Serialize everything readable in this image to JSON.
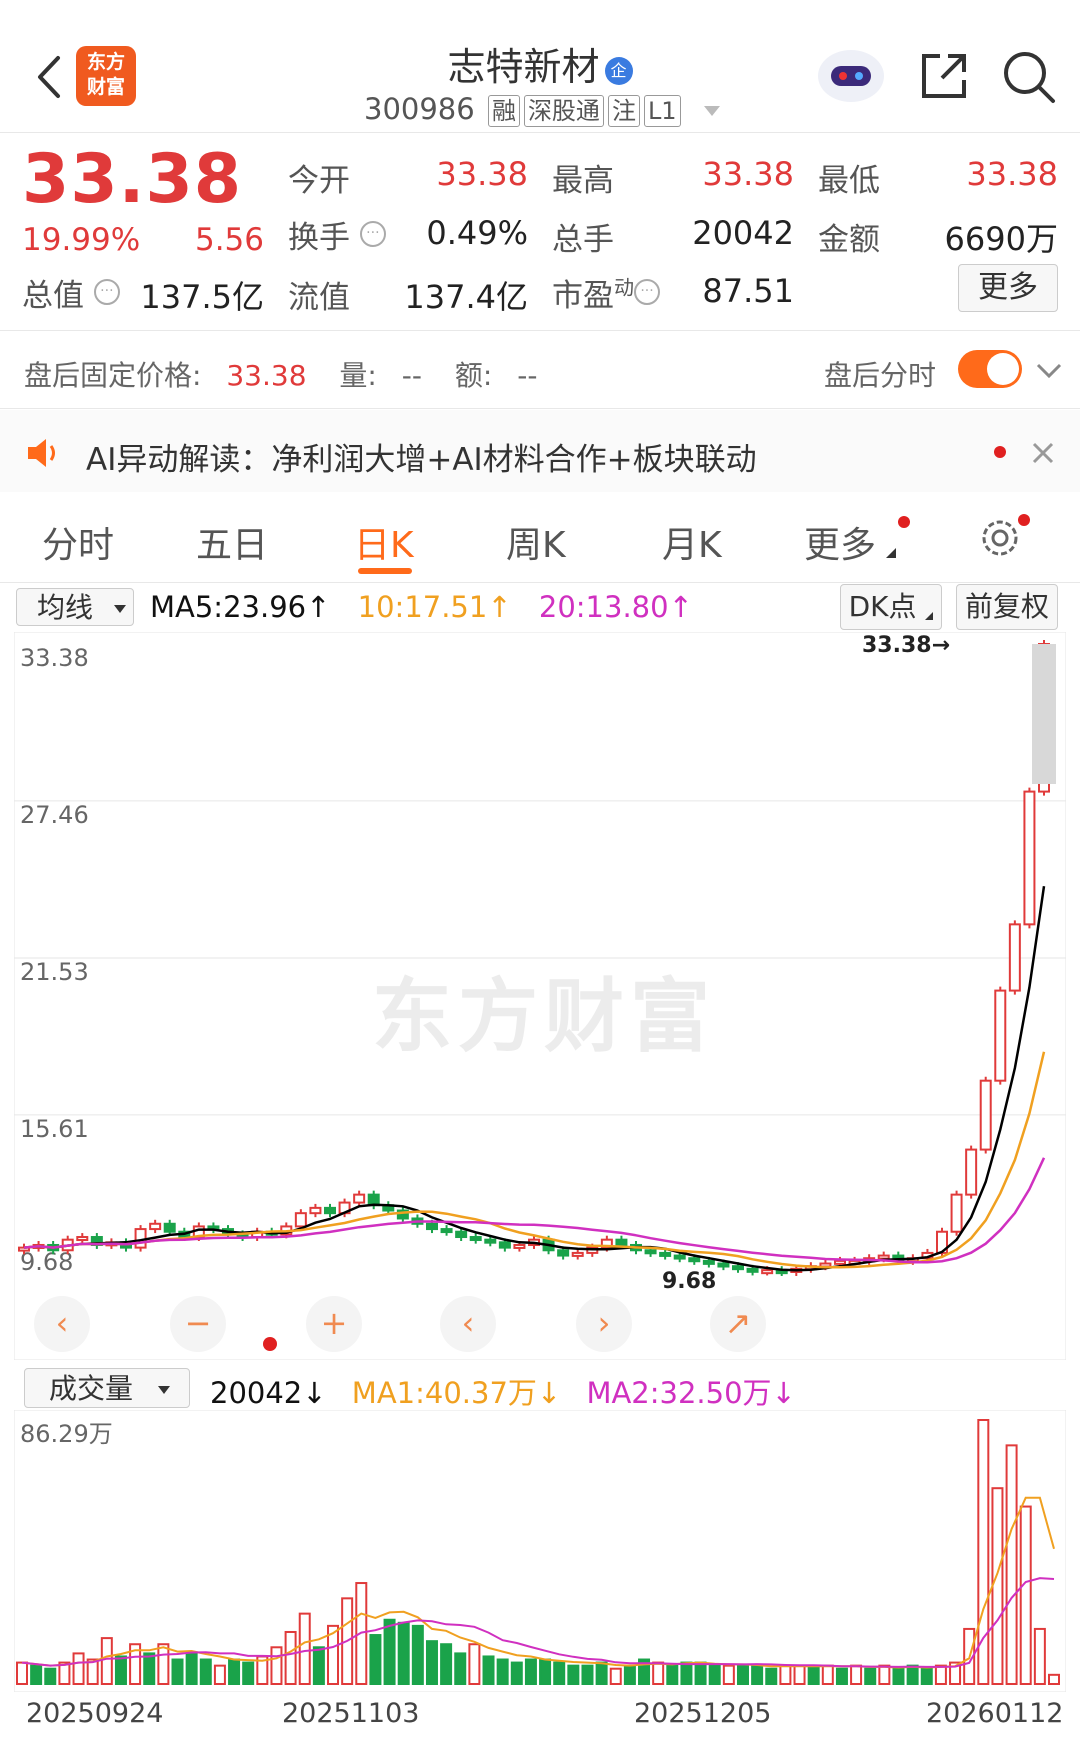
{
  "header": {
    "name": "志特新材",
    "code": "300986",
    "badges": [
      "融",
      "深股通",
      "注",
      "L1"
    ],
    "logo_lines": [
      "东方",
      "财富"
    ],
    "name_badge": "企"
  },
  "quote": {
    "price": "33.38",
    "change_pct": "19.99%",
    "change": "5.56",
    "rows": [
      [
        {
          "label": "今开",
          "value": "33.38",
          "red": true
        },
        {
          "label": "最高",
          "value": "33.38",
          "red": true
        },
        {
          "label": "最低",
          "value": "33.38",
          "red": true
        }
      ],
      [
        {
          "label": "换手",
          "value": "0.49%",
          "red": false
        },
        {
          "label": "总手",
          "value": "20042",
          "red": false
        },
        {
          "label": "金额",
          "value": "6690万",
          "red": false
        }
      ]
    ],
    "total_cap_label": "总值",
    "total_cap": "137.5亿",
    "float_cap_label": "流值",
    "float_cap": "137.4亿",
    "pe_label": "市盈",
    "pe_sup": "动",
    "pe": "87.51",
    "more_button": "更多"
  },
  "after_hours": {
    "price_label": "盘后固定价格:",
    "price": "33.38",
    "volume_label": "量:",
    "volume": "--",
    "amount_label": "额:",
    "amount": "--",
    "timeshare_label": "盘后分时",
    "toggle_on": true
  },
  "ai_banner": {
    "text": "AI异动解读：净利润大增+AI材料合作+板块联动"
  },
  "tabs": [
    "分时",
    "五日",
    "日K",
    "周K",
    "月K",
    "更多"
  ],
  "active_tab": "日K",
  "kline": {
    "indicator_select": "均线",
    "ma5": "MA5:23.96",
    "ma10": "10:17.51",
    "ma20": "20:13.80",
    "dk_button": "DK点",
    "adjust_button": "前复权",
    "watermark": "东方财富",
    "last_price_tag": "33.38",
    "low_tag": "9.68"
  },
  "volume_panel": {
    "select": "成交量",
    "value": "20042",
    "ma1": "MA1:40.37万",
    "ma2": "MA2:32.50万"
  },
  "colors": {
    "up": "#e03a3a",
    "down": "#1aa34a",
    "ma5": "#000000",
    "ma10": "#f0a020",
    "ma20": "#d030c0",
    "accent": "#ff6a1a"
  },
  "chart_data": [
    {
      "type": "candlestick",
      "y_ticks": [
        "33.38",
        "27.46",
        "21.53",
        "15.61",
        "9.68"
      ],
      "ylim": [
        9.68,
        33.38
      ],
      "x_ticks": [
        "20250924",
        "20251103",
        "20251205",
        "20260112"
      ],
      "series": [
        {
          "name": "MA5",
          "last": 23.96
        },
        {
          "name": "MA10",
          "last": 17.51
        },
        {
          "name": "MA20",
          "last": 13.8
        }
      ],
      "close": [
        10.6,
        10.7,
        10.5,
        10.9,
        11.0,
        10.7,
        10.8,
        10.6,
        11.3,
        11.5,
        11.2,
        11.0,
        11.4,
        11.3,
        11.1,
        11.0,
        11.2,
        11.1,
        11.4,
        11.9,
        12.1,
        11.9,
        12.3,
        12.6,
        12.2,
        12.0,
        11.7,
        11.5,
        11.3,
        11.2,
        11.0,
        10.9,
        10.8,
        10.6,
        10.7,
        10.9,
        10.5,
        10.3,
        10.4,
        10.6,
        10.9,
        10.7,
        10.5,
        10.4,
        10.3,
        10.2,
        10.1,
        10.0,
        9.9,
        9.8,
        9.7,
        9.75,
        9.68,
        9.8,
        9.9,
        10.0,
        10.1,
        10.1,
        10.2,
        10.3,
        10.1,
        10.2,
        10.4,
        11.2,
        12.6,
        14.3,
        16.9,
        20.3,
        22.8,
        27.81,
        33.38
      ],
      "note_high": 33.38,
      "note_low": 9.68
    },
    {
      "type": "bar",
      "y_ticks": [
        "86.29万"
      ],
      "ylim": [
        0,
        86.29
      ],
      "values": [
        7,
        6,
        5,
        7,
        10,
        8,
        15,
        9,
        13,
        10,
        13,
        8,
        10,
        8,
        6,
        8,
        7,
        9,
        12,
        17,
        23,
        12,
        19,
        28,
        33,
        16,
        21,
        20,
        19,
        14,
        13,
        10,
        13,
        9,
        8,
        7,
        8,
        8,
        7,
        6,
        6,
        7,
        5,
        6,
        8,
        7,
        6,
        7,
        7,
        6,
        6,
        6,
        6,
        5,
        6,
        6,
        6,
        6,
        5,
        6,
        5,
        6,
        5,
        6,
        5,
        6,
        7,
        18,
        86.29,
        64,
        78,
        58,
        18,
        3
      ],
      "up": [
        1,
        0,
        0,
        1,
        1,
        1,
        1,
        0,
        1,
        0,
        1,
        0,
        0,
        0,
        1,
        0,
        0,
        1,
        1,
        1,
        1,
        0,
        1,
        1,
        1,
        0,
        0,
        0,
        0,
        0,
        0,
        0,
        1,
        0,
        0,
        0,
        0,
        0,
        0,
        0,
        0,
        0,
        1,
        0,
        0,
        1,
        0,
        0,
        0,
        0,
        1,
        0,
        0,
        0,
        1,
        1,
        0,
        1,
        0,
        1,
        0,
        1,
        0,
        0,
        0,
        1,
        1,
        1,
        1,
        1,
        1,
        1,
        1,
        1
      ],
      "series": [
        {
          "name": "MA1",
          "last": "40.37万"
        },
        {
          "name": "MA2",
          "last": "32.50万"
        }
      ]
    }
  ]
}
